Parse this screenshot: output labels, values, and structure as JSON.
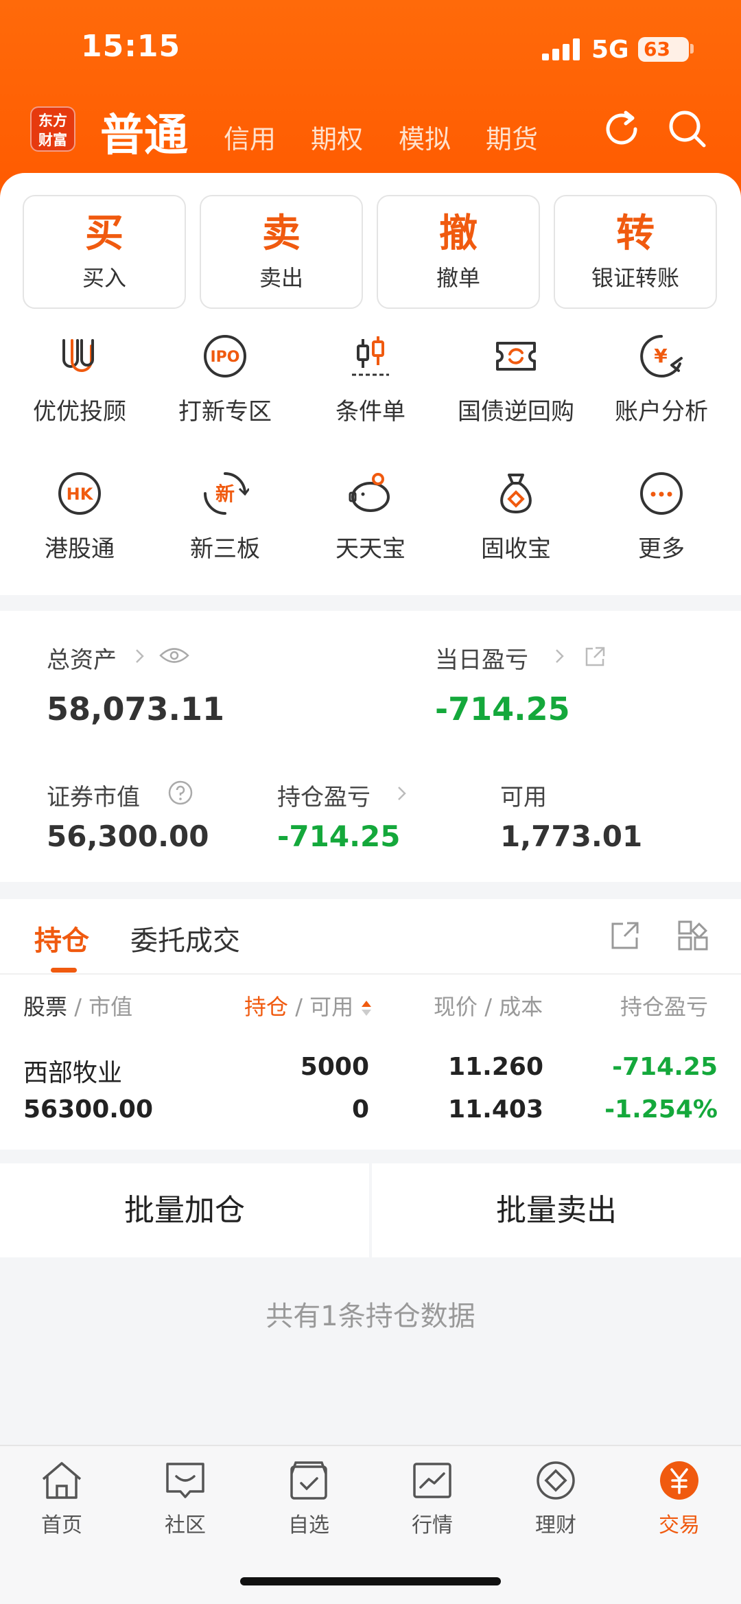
{
  "status": {
    "time": "15:15",
    "network": "5G",
    "battery": "63"
  },
  "colors": {
    "brand": "#ff5a00",
    "accent": "#f05a0f",
    "gain_loss": "#14a83b"
  },
  "topnav": {
    "logo_line1": "东方",
    "logo_line2": "财富",
    "active_tab": "普通",
    "tabs": [
      "信用",
      "期权",
      "模拟",
      "期货"
    ],
    "icons": [
      "refresh-icon",
      "search-icon"
    ]
  },
  "quick_actions": [
    {
      "big": "买",
      "label": "买入"
    },
    {
      "big": "卖",
      "label": "卖出"
    },
    {
      "big": "撤",
      "label": "撤单"
    },
    {
      "big": "转",
      "label": "银证转账"
    }
  ],
  "services": [
    {
      "label": "优优投顾",
      "icon": "uu-advisor-icon"
    },
    {
      "label": "打新专区",
      "icon": "ipo-icon",
      "icon_text": "IPO"
    },
    {
      "label": "条件单",
      "icon": "candlestick-icon"
    },
    {
      "label": "国债逆回购",
      "icon": "bond-repo-icon"
    },
    {
      "label": "账户分析",
      "icon": "account-analysis-icon",
      "icon_text": "¥"
    },
    {
      "label": "港股通",
      "icon": "hk-connect-icon",
      "icon_text": "HK"
    },
    {
      "label": "新三板",
      "icon": "neeq-icon",
      "icon_text": "新"
    },
    {
      "label": "天天宝",
      "icon": "piggy-bank-icon"
    },
    {
      "label": "固收宝",
      "icon": "money-bag-icon"
    },
    {
      "label": "更多",
      "icon": "more-icon"
    }
  ],
  "assets": {
    "total_label": "总资产",
    "total_value": "58,073.11",
    "daily_label": "当日盈亏",
    "daily_value": "-714.25",
    "market_value_label": "证券市值",
    "market_value": "56,300.00",
    "position_pl_label": "持仓盈亏",
    "position_pl": "-714.25",
    "available_label": "可用",
    "available": "1,773.01"
  },
  "holdings": {
    "tabs": [
      "持仓",
      "委托成交"
    ],
    "columns": {
      "c1a": "股票",
      "c1b": "市值",
      "c2a": "持仓",
      "c2b": "可用",
      "c3a": "现价",
      "c3b": "成本",
      "c4": "持仓盈亏"
    },
    "rows": [
      {
        "name": "西部牧业",
        "market_value": "56300.00",
        "position": "5000",
        "available": "0",
        "price": "11.260",
        "cost": "11.403",
        "pl": "-714.25",
        "pl_pct": "-1.254%"
      }
    ],
    "batch_add": "批量加仓",
    "batch_sell": "批量卖出",
    "summary": "共有1条持仓数据"
  },
  "tabbar": [
    {
      "label": "首页",
      "icon": "home-icon"
    },
    {
      "label": "社区",
      "icon": "community-icon"
    },
    {
      "label": "自选",
      "icon": "watchlist-icon"
    },
    {
      "label": "行情",
      "icon": "market-icon"
    },
    {
      "label": "理财",
      "icon": "wealth-icon"
    },
    {
      "label": "交易",
      "icon": "trade-icon",
      "active": true
    }
  ]
}
